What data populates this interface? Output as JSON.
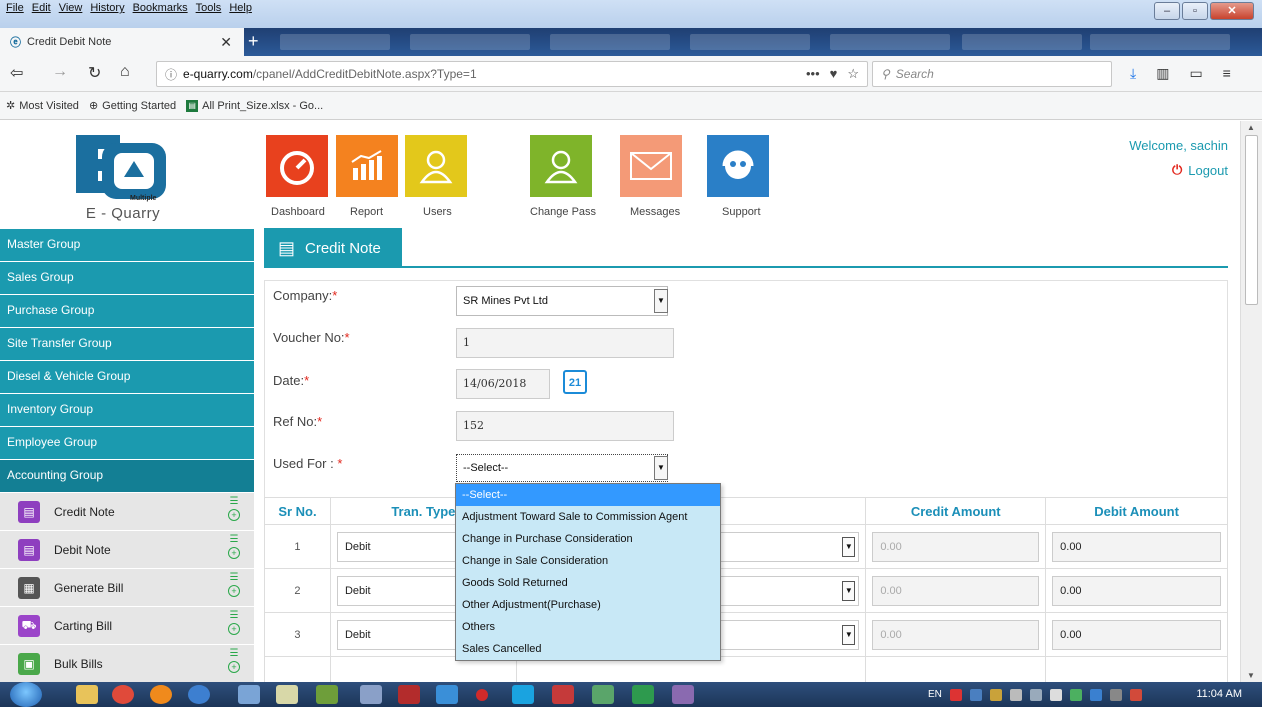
{
  "browser": {
    "menu": [
      "File",
      "Edit",
      "View",
      "History",
      "Bookmarks",
      "Tools",
      "Help"
    ],
    "active_tab": "Credit Debit Note",
    "url_domain": "e-quarry.com",
    "url_path": "/cpanel/AddCreditDebitNote.aspx?Type=1",
    "search_placeholder": "Search",
    "bookmarks": [
      "Most Visited",
      "Getting Started",
      "All Print_Size.xlsx - Go..."
    ]
  },
  "logo": {
    "brand": "E - Quarry",
    "tag": "Multiple"
  },
  "header": {
    "tiles": [
      {
        "label": "Dashboard",
        "color": "#e8411e"
      },
      {
        "label": "Report",
        "color": "#f4821f"
      },
      {
        "label": "Users",
        "color": "#e3c81b"
      },
      {
        "label": "Change Pass",
        "color": "#7fb42a"
      },
      {
        "label": "Messages",
        "color": "#f49a77"
      },
      {
        "label": "Support",
        "color": "#2a7fc7"
      }
    ],
    "welcome": "Welcome, sachin",
    "logout": "Logout"
  },
  "sidebar": {
    "groups": [
      "Master Group",
      "Sales Group",
      "Purchase Group",
      "Site Transfer Group",
      "Diesel & Vehicle Group",
      "Inventory Group",
      "Employee Group",
      "Accounting Group"
    ],
    "items": [
      {
        "label": "Credit Note"
      },
      {
        "label": "Debit Note"
      },
      {
        "label": "Generate Bill"
      },
      {
        "label": "Carting Bill"
      },
      {
        "label": "Bulk Bills"
      }
    ]
  },
  "content": {
    "title": "Credit Note"
  },
  "form": {
    "company_label": "Company:",
    "company_value": "SR Mines Pvt Ltd",
    "voucher_label": "Voucher No:",
    "voucher_value": "1",
    "date_label": "Date:",
    "date_value": "14/06/2018",
    "calendar_day": "21",
    "ref_label": "Ref No:",
    "ref_value": "152",
    "used_for_label": "Used For :",
    "used_for_value": "--Select--",
    "required_mark": "*"
  },
  "table": {
    "headers": [
      "Sr No.",
      "Tran. Type",
      "",
      "Credit Amount",
      "Debit Amount"
    ],
    "rows": [
      {
        "sr": "1",
        "type": "Debit",
        "credit": "0.00",
        "debit": "0.00"
      },
      {
        "sr": "2",
        "type": "Debit",
        "credit": "0.00",
        "debit": "0.00"
      },
      {
        "sr": "3",
        "type": "Debit",
        "credit": "0.00",
        "debit": "0.00"
      }
    ]
  },
  "dropdown": {
    "options": [
      "--Select--",
      "Adjustment Toward Sale to Commission Agent",
      "Change in Purchase Consideration",
      "Change in Sale Consideration",
      "Goods Sold Returned",
      "Other Adjustment(Purchase)",
      "Others",
      "Sales Cancelled"
    ]
  },
  "taskbar": {
    "lang": "EN",
    "time": "11:04 AM"
  },
  "colors": {
    "accent": "#1b9aaf",
    "required": "#e2261c"
  }
}
